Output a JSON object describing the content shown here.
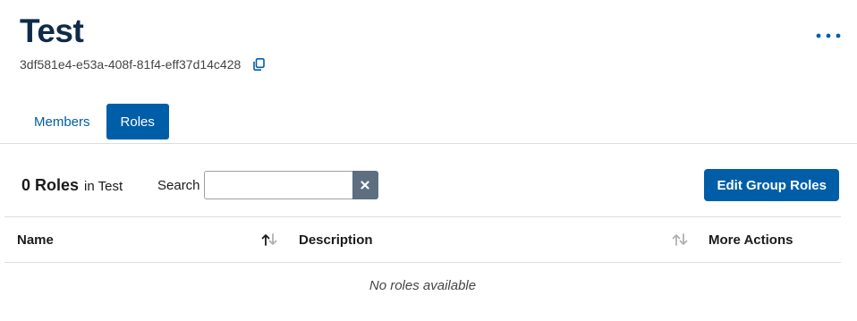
{
  "header": {
    "title": "Test",
    "group_id": "3df581e4-e53a-408f-81f4-eff37d14c428"
  },
  "tabs": [
    {
      "label": "Members",
      "active": false
    },
    {
      "label": "Roles",
      "active": true
    }
  ],
  "toolbar": {
    "count_label": "0 Roles",
    "count_context": "in Test",
    "search_label": "Search",
    "search_value": "",
    "search_placeholder": "",
    "edit_button_label": "Edit Group Roles"
  },
  "table": {
    "columns": [
      {
        "label": "Name",
        "sortable": true,
        "sort_state": "ascending"
      },
      {
        "label": "Description",
        "sortable": true,
        "sort_state": "none"
      },
      {
        "label": "More Actions",
        "sortable": false
      }
    ],
    "rows": [],
    "empty_text": "No roles available"
  },
  "colors": {
    "primary": "#005ea8",
    "title": "#0f2b4a",
    "clear_button": "#5c6e80",
    "divider": "#dcdcdc"
  },
  "icons": {
    "copy": "copy-icon",
    "more": "more-horizontal-icon",
    "clear": "close-icon",
    "sort_name": "sort-ascending-icon",
    "sort_desc": "sort-icon"
  }
}
